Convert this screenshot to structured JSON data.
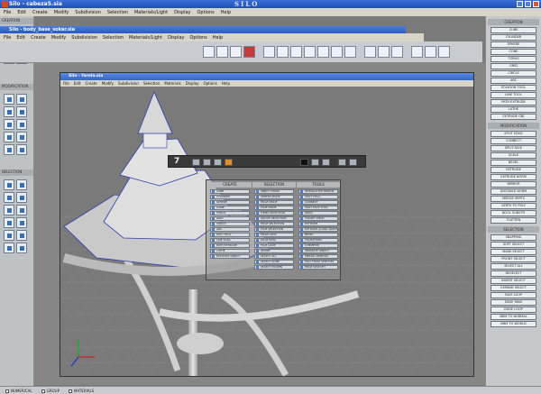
{
  "app": {
    "title": "Silo - cabeza5.sia",
    "logo": "SILO"
  },
  "menus": [
    "File",
    "Edit",
    "Create",
    "Modify",
    "Subdivision",
    "Selection",
    "Materials/Light",
    "Display",
    "Options",
    "Help"
  ],
  "inner_window": {
    "title": "Silo - body_base_sokar.sia",
    "menus": [
      "File",
      "Edit",
      "Create",
      "Modify",
      "Subdivision",
      "Selection",
      "Materials/Light",
      "Display",
      "Options",
      "Help"
    ]
  },
  "front_window": {
    "title": "Silo - farola.sia",
    "menus": [
      "File",
      "Edit",
      "Create",
      "Modify",
      "Subdivision",
      "Selection",
      "Materials",
      "Display",
      "Options",
      "Help"
    ]
  },
  "left_panel": {
    "sections": [
      "CREATION",
      "MODIFICATION",
      "SELECTION"
    ]
  },
  "right_panel": {
    "creation_header": "CREATION",
    "creation": [
      "CUBE",
      "CYLINDER",
      "SPHERE",
      "CONE",
      "TORUS",
      "GRID",
      "CIRCLE",
      "ARC",
      "POLYGON TOOL",
      "LINE TOOL",
      "PATH EXTRUDE",
      "LATHE",
      "EXTRUDE OBJ"
    ],
    "modification_header": "MODIFICATION",
    "modification": [
      "SPLIT EDGE",
      "CONNECT",
      "SPLIT FACE",
      "SCALE",
      "BEVEL",
      "EXTRUDE",
      "EXTRUDE NORM",
      "MIRROR",
      "DISTANCE NORM",
      "MERGE VERTS",
      "VERTS TO POLY",
      "BOOL SUBSTR",
      "FLATTEN"
    ],
    "selection_header": "SELECTION",
    "selection": [
      "SNAPPING",
      "SOFT SELECT",
      "MASK SELECT",
      "FRONT SELECT",
      "SELECT ALL",
      "DESELECT",
      "INVERT SELECT",
      "EXPAND SELECT",
      "FACE LOOP",
      "EDGE RING",
      "EDGE LOOP",
      "NRM TO NORMAL",
      "NRM TO WORLD"
    ]
  },
  "float_toolbar": {
    "number": "7"
  },
  "pie_menu": {
    "headers": [
      "CREATE",
      "SELECTION",
      "TOOLS"
    ],
    "create": [
      "CUBE",
      "CYLINDER",
      "SPHERE",
      "CONE",
      "TORUS",
      "GRID",
      "CIRCLE",
      "ARC",
      "POLY TOOL",
      "LINE TOOL",
      "PATH EXTRUDE",
      "LATHE",
      "EXTRUDE OBJECT"
    ],
    "selection": [
      "OBJECT MODE",
      "VERTEX MODE",
      "EDGE MODE",
      "FACE MODE",
      "ITEMS SELECTION",
      "GROUP SELECTION",
      "EDGE SELECTION",
      "FACE SELECTION",
      "EDGE LOOP",
      "EDGE RING",
      "FACE LOOP",
      "INVERT",
      "SELECT ALL",
      "SELECT NONE",
      "SELECT HIDDEN"
    ],
    "tools": [
      "INTERACTIVE MIRROR",
      "SPLIT TOOL",
      "CONNECT",
      "SPLIT FACE TOOL",
      "WELD",
      "TARGET WELD",
      "EXTRUDE",
      "EXTRUDE ALONG NORMAL",
      "BEVEL",
      "TRANSFORM",
      "SYMMETRY",
      "SEPARATE OBJECT",
      "MERGE VERTICES",
      "POLY FROM VERTICES",
      "EDGE SMOOTH"
    ]
  },
  "statusbar": {
    "items": [
      "NUMERICAL",
      "GROUP",
      "MATERIALS"
    ]
  },
  "colors": {
    "titlebar": "#2a5cc6",
    "panel": "#c6c9cb",
    "viewport": "#7a7a7a",
    "model": "#d9d9d9"
  }
}
